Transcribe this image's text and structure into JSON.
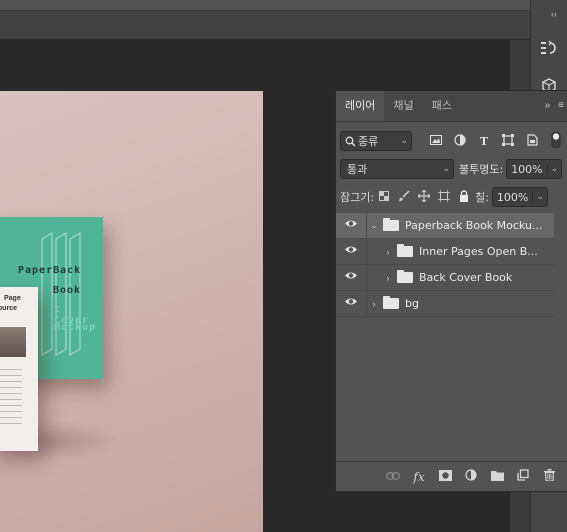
{
  "panel": {
    "tabs": [
      {
        "label": "레이어",
        "active": true
      },
      {
        "label": "채널",
        "active": false
      },
      {
        "label": "패스",
        "active": false
      }
    ],
    "tab_tools": {
      "collapse": "»",
      "menu": "≡"
    },
    "filter": {
      "value": "종류"
    },
    "filter_icons": [
      "image-filter-icon",
      "adjustment-filter-icon",
      "type-filter-icon",
      "shape-filter-icon",
      "smart-object-filter-icon",
      "filter-toggle"
    ],
    "blend": {
      "value": "통과"
    },
    "opacity": {
      "label": "불투명도:",
      "value": "100%"
    },
    "lock": {
      "label": "잠그기:"
    },
    "fill": {
      "label": "칠:",
      "value": "100%"
    },
    "layers": [
      {
        "name": "Paperback Book Mocku...",
        "indent": 0,
        "expanded": true,
        "selected": true
      },
      {
        "name": "Inner Pages Open B...",
        "indent": 1,
        "expanded": false,
        "selected": false
      },
      {
        "name": "Back Cover Book",
        "indent": 1,
        "expanded": false,
        "selected": false
      },
      {
        "name": "bg",
        "indent": 0,
        "expanded": false,
        "selected": false
      }
    ],
    "footer_icons": [
      "link-icon",
      "fx-icon",
      "mask-icon",
      "adjustment-icon",
      "group-icon",
      "new-layer-icon",
      "trash-icon"
    ]
  },
  "document": {
    "green_book": {
      "line1": "PaperBack",
      "line2": "Book",
      "line3": "t Cover",
      "line4": "Mockup"
    },
    "white_book": {
      "line1": "Page",
      "line2": "ource"
    }
  },
  "colors": {
    "accent_bg": "#535353",
    "selected_row": "#676767",
    "green_cover": "#4fb596",
    "canvas_bg": "#d9c3bf"
  }
}
